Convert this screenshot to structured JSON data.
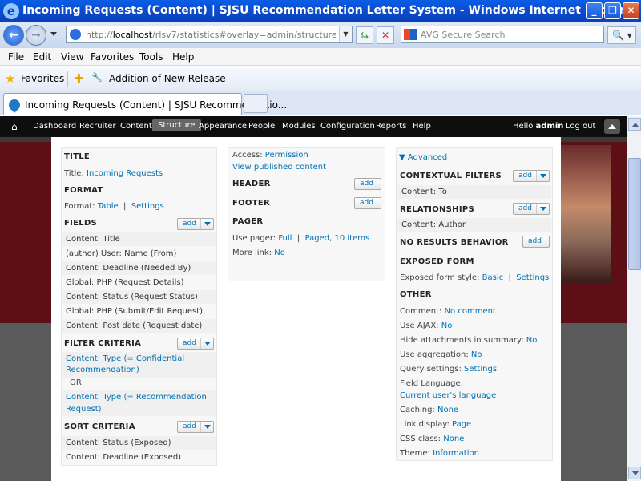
{
  "window": {
    "title": "Incoming Requests (Content) | SJSU Recommendation Letter System - Windows Internet Explorer",
    "minimize": "_",
    "restore": "❐",
    "close": "✕"
  },
  "address": {
    "url_prefix": "http://",
    "url_host": "localhost",
    "url_rest": "/rlsv7/statistics#overlay=admin/structure/views/v",
    "search_placeholder": "AVG Secure Search"
  },
  "menu": [
    "File",
    "Edit",
    "View",
    "Favorites",
    "Tools",
    "Help"
  ],
  "favorites": {
    "label": "Favorites",
    "item": "Addition of New Release"
  },
  "tab": {
    "label": "Incoming Requests (Content) | SJSU Recommendatio..."
  },
  "toolbar": {
    "items": [
      "Dashboard",
      "Recruiter",
      "Content",
      "Structure",
      "Appearance",
      "People",
      "Modules",
      "Configuration",
      "Reports",
      "Help"
    ],
    "active": "Structure",
    "hello": "Hello",
    "user": "admin",
    "logout": "Log out"
  },
  "left": {
    "title_section": "TITLE",
    "title_label": "Title:",
    "title_value": "Incoming Requests",
    "format_section": "FORMAT",
    "format_label": "Format:",
    "format_value": "Table",
    "format_settings": "Settings",
    "fields_section": "FIELDS",
    "add": "add",
    "fields": [
      "Content: Title",
      "(author) User: Name (From)",
      "Content: Deadline (Needed By)",
      "Global: PHP (Request Details)",
      "Content: Status (Request Status)",
      "Global: PHP (Submit/Edit Request)",
      "Content: Post date (Request date)"
    ],
    "filter_section": "FILTER CRITERIA",
    "filters": [
      "Content: Type (= Confidential",
      "Recommendation)",
      "OR",
      "Content: Type (= Recommendation",
      "Request)"
    ],
    "sort_section": "SORT CRITERIA",
    "sorts": [
      "Content: Status (Exposed)",
      "Content: Deadline (Exposed)"
    ]
  },
  "middle": {
    "access_label": "Access:",
    "access_value": "Permission",
    "access_sep": "|",
    "access_link": "View published content",
    "header_section": "HEADER",
    "footer_section": "FOOTER",
    "pager_section": "PAGER",
    "pager_label": "Use pager:",
    "pager_value": "Full",
    "pager_sep": "|",
    "pager_items": "Paged, 10 items",
    "more_label": "More link:",
    "more_value": "No",
    "add": "add"
  },
  "right": {
    "advanced": "▼ Advanced",
    "contextual_section": "CONTEXTUAL FILTERS",
    "contextual_item": "Content: To",
    "relationships_section": "RELATIONSHIPS",
    "relationships_item": "Content: Author",
    "noresults_section": "NO RESULTS BEHAVIOR",
    "exposed_section": "EXPOSED FORM",
    "exposed_label": "Exposed form style:",
    "exposed_value": "Basic",
    "exposed_sep": "|",
    "exposed_settings": "Settings",
    "other_section": "OTHER",
    "add": "add",
    "other": [
      {
        "label": "Comment:",
        "value": "No comment"
      },
      {
        "label": "Use AJAX:",
        "value": "No"
      },
      {
        "label": "Hide attachments in summary:",
        "value": "No"
      },
      {
        "label": "Use aggregation:",
        "value": "No"
      },
      {
        "label": "Query settings:",
        "value": "Settings"
      },
      {
        "label": "Field Language:",
        "value": ""
      },
      {
        "label": "",
        "value": "Current user's language"
      },
      {
        "label": "Caching:",
        "value": "None"
      },
      {
        "label": "Link display:",
        "value": "Page"
      },
      {
        "label": "CSS class:",
        "value": "None"
      },
      {
        "label": "Theme:",
        "value": "Information"
      }
    ]
  }
}
